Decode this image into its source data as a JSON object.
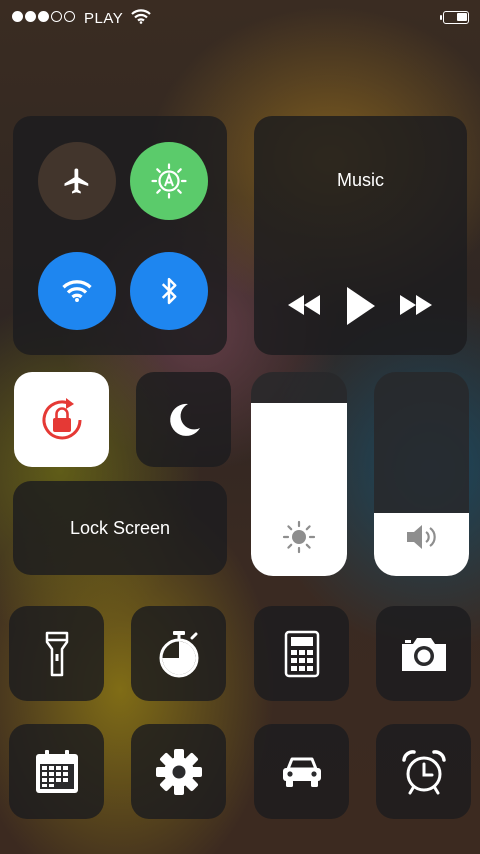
{
  "status_bar": {
    "signal_strength": 3,
    "signal_max": 5,
    "carrier": "PLAY",
    "battery_level": 0.5
  },
  "connectivity": {
    "airplane_mode": {
      "icon": "airplane-icon",
      "on": false
    },
    "auto_brightness": {
      "icon": "auto-brightness-icon",
      "on": true,
      "color": "#5BCB6B"
    },
    "wifi": {
      "icon": "wifi-icon",
      "on": true,
      "color": "#1E86F0"
    },
    "bluetooth": {
      "icon": "bluetooth-icon",
      "on": true,
      "color": "#1E86F0"
    }
  },
  "music": {
    "title": "Music",
    "controls": [
      "rewind-icon",
      "play-icon",
      "fast-forward-icon"
    ]
  },
  "toggles": {
    "rotation_lock": {
      "icon": "rotation-lock-icon",
      "on": true,
      "color": "#E53935"
    },
    "do_not_disturb": {
      "icon": "moon-icon",
      "on": false
    }
  },
  "lock_screen": {
    "label": "Lock Screen"
  },
  "brightness": {
    "icon": "sun-icon",
    "level": 0.85
  },
  "volume": {
    "icon": "speaker-icon",
    "level": 0.31
  },
  "shortcuts": [
    {
      "name": "flashlight",
      "icon": "flashlight-icon"
    },
    {
      "name": "timer",
      "icon": "timer-icon"
    },
    {
      "name": "calculator",
      "icon": "calculator-icon"
    },
    {
      "name": "camera",
      "icon": "camera-icon"
    },
    {
      "name": "calendar",
      "icon": "calendar-icon"
    },
    {
      "name": "settings",
      "icon": "settings-icon"
    },
    {
      "name": "car",
      "icon": "car-icon"
    },
    {
      "name": "alarm",
      "icon": "alarm-clock-icon"
    }
  ]
}
